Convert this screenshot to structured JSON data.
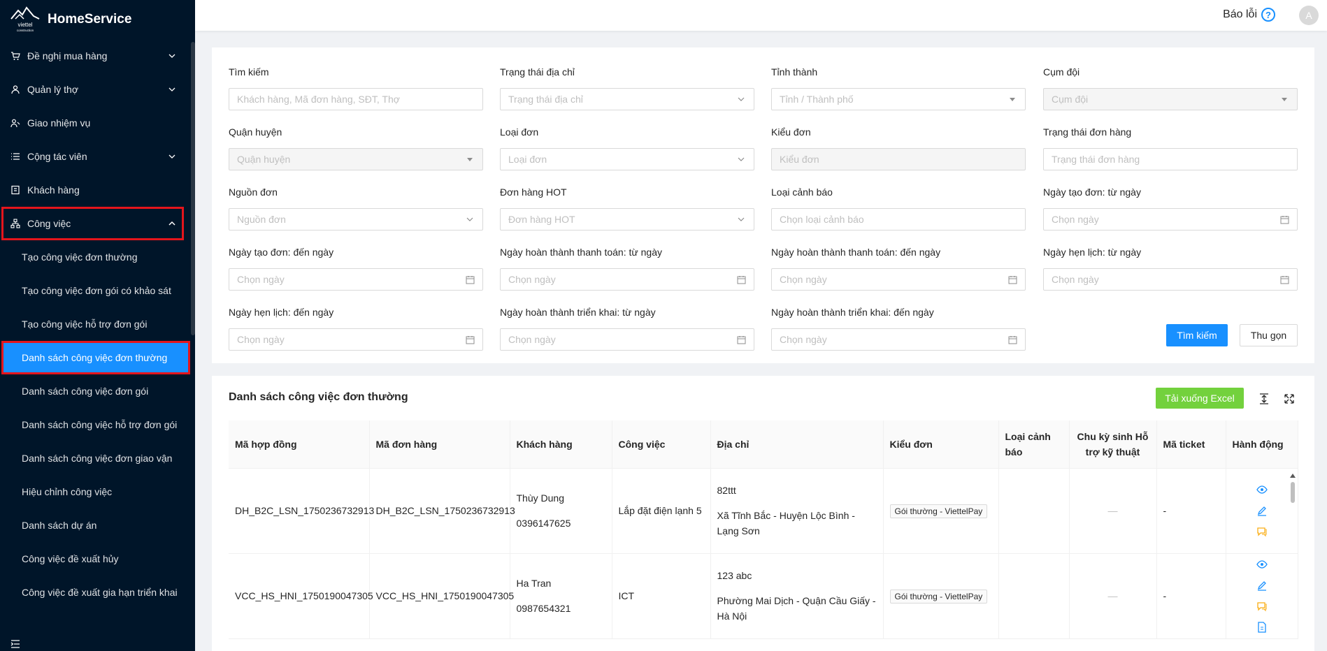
{
  "app": {
    "name": "HomeService"
  },
  "sidebar": {
    "items": [
      {
        "label": "Đề nghị mua hàng",
        "icon": "cart-icon",
        "expandable": true
      },
      {
        "label": "Quản lý thợ",
        "icon": "worker-icon",
        "expandable": true
      },
      {
        "label": "Giao nhiệm vụ",
        "icon": "assign-icon",
        "expandable": false
      },
      {
        "label": "Cộng tác viên",
        "icon": "list-icon",
        "expandable": true
      },
      {
        "label": "Khách hàng",
        "icon": "customer-icon",
        "expandable": false
      },
      {
        "label": "Công việc",
        "icon": "network-icon",
        "expandable": true,
        "open": true
      }
    ],
    "sub_items": [
      "Tạo công việc đơn thường",
      "Tạo công việc đơn gói có khảo sát",
      "Tạo công việc hỗ trợ đơn gói",
      "Danh sách công việc đơn thường",
      "Danh sách công việc đơn gói",
      "Danh sách công việc hỗ trợ đơn gói",
      "Danh sách công việc đơn giao vận",
      "Hiệu chỉnh công việc",
      "Danh sách dự án",
      "Công việc đề xuất hủy",
      "Công việc đề xuất gia hạn triển khai"
    ],
    "active_sub_index": 3
  },
  "header": {
    "report_label": "Báo lỗi",
    "avatar_letter": "A"
  },
  "filters": {
    "search": {
      "label": "Tìm kiếm",
      "placeholder": "Khách hàng, Mã đơn hàng, SĐT, Thợ"
    },
    "address_status": {
      "label": "Trạng thái địa chỉ",
      "placeholder": "Trạng thái địa chỉ"
    },
    "province": {
      "label": "Tỉnh thành",
      "placeholder": "Tỉnh / Thành phố"
    },
    "team_cluster": {
      "label": "Cụm đội",
      "placeholder": "Cụm đội"
    },
    "district": {
      "label": "Quận huyện",
      "placeholder": "Quận huyện"
    },
    "order_category": {
      "label": "Loại đơn",
      "placeholder": "Loại đơn"
    },
    "order_type": {
      "label": "Kiểu đơn",
      "placeholder": "Kiểu đơn"
    },
    "order_status": {
      "label": "Trạng thái đơn hàng",
      "placeholder": "Trạng thái đơn hàng"
    },
    "order_source": {
      "label": "Nguồn đơn",
      "placeholder": "Nguồn đơn"
    },
    "hot_order": {
      "label": "Đơn hàng HOT",
      "placeholder": "Đơn hàng HOT"
    },
    "warning_type": {
      "label": "Loại cảnh báo",
      "placeholder": "Chọn loại cảnh báo"
    },
    "created_from": {
      "label": "Ngày tạo đơn: từ ngày",
      "placeholder": "Chọn ngày"
    },
    "created_to": {
      "label": "Ngày tạo đơn: đến ngày",
      "placeholder": "Chọn ngày"
    },
    "paid_from": {
      "label": "Ngày hoàn thành thanh toán: từ ngày",
      "placeholder": "Chọn ngày"
    },
    "paid_to": {
      "label": "Ngày hoàn thành thanh toán: đến ngày",
      "placeholder": "Chọn ngày"
    },
    "appt_from": {
      "label": "Ngày hẹn lịch: từ ngày",
      "placeholder": "Chọn ngày"
    },
    "appt_to": {
      "label": "Ngày hẹn lịch: đến ngày",
      "placeholder": "Chọn ngày"
    },
    "deploy_from": {
      "label": "Ngày hoàn thành triển khai: từ ngày",
      "placeholder": "Chọn ngày"
    },
    "deploy_to": {
      "label": "Ngày hoàn thành triển khai: đến ngày",
      "placeholder": "Chọn ngày"
    },
    "search_button": "Tìm kiếm",
    "collapse_button": "Thu gọn"
  },
  "table": {
    "title": "Danh sách công việc đơn thường",
    "export_button": "Tải xuống Excel",
    "columns": [
      "Mã hợp đồng",
      "Mã đơn hàng",
      "Khách hàng",
      "Công việc",
      "Địa chỉ",
      "Kiểu đơn",
      "Loại cảnh báo",
      "Chu kỳ sinh Hỗ trợ kỹ thuật",
      "Mã ticket",
      "Hành động"
    ],
    "rows": [
      {
        "contract": "DH_B2C_LSN_1750236732913",
        "order": "DH_B2C_LSN_1750236732913",
        "customer_name": "Thùy Dung",
        "customer_phone": "0396147625",
        "job": "Lắp đặt điện lạnh 5",
        "address_line1": "82ttt",
        "address_line2": "Xã Tĩnh Bắc - Huyện Lộc Bình - Lạng Sơn",
        "order_type": "Gói thường - ViettelPay",
        "warning": "",
        "cycle": "—",
        "ticket": "-"
      },
      {
        "contract": "VCC_HS_HNI_1750190047305",
        "order": "VCC_HS_HNI_1750190047305",
        "customer_name": "Ha Tran",
        "customer_phone": "0987654321",
        "job": "ICT",
        "address_line1": "123 abc",
        "address_line2": "Phường Mai Dịch - Quận Cầu Giấy - Hà Nội",
        "order_type": "Gói thường - ViettelPay",
        "warning": "",
        "cycle": "—",
        "ticket": "-"
      }
    ]
  },
  "colors": {
    "sidebar_bg": "#001529",
    "primary": "#1890ff",
    "excel": "#73d13d",
    "highlight": "#e4151c"
  }
}
